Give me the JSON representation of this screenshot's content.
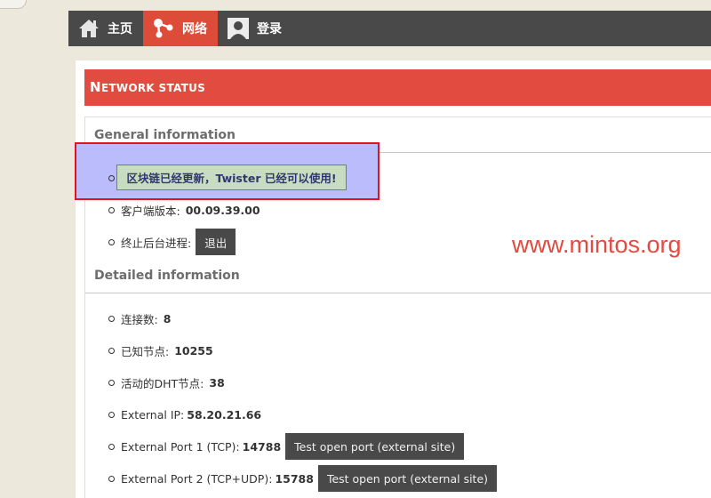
{
  "navbar": {
    "items": [
      {
        "label": "主页",
        "icon": "home-icon"
      },
      {
        "label": "网络",
        "icon": "network-icon",
        "active": true
      },
      {
        "label": "登录",
        "icon": "user-icon"
      }
    ]
  },
  "title": {
    "first": "N",
    "rest": "ETWORK STATUS"
  },
  "general": {
    "heading": "General information",
    "notice": "区块链已经更新，Twister 已经可以使用!",
    "client_version_label": "客户端版本:",
    "client_version": "00.09.39.00",
    "stop_label": "终止后台进程:",
    "stop_button": "退出"
  },
  "detailed": {
    "heading": "Detailed information",
    "connections_label": "连接数:",
    "connections": "8",
    "known_nodes_label": "已知节点:",
    "known_nodes": "10255",
    "dht_nodes_label": "活动的DHT节点:",
    "dht_nodes": "38",
    "ext_ip_label": "External IP:",
    "ext_ip": "58.20.21.66",
    "port1_label": "External Port 1 (TCP):",
    "port1": "14788",
    "port1_button": "Test open port (external site)",
    "port2_label": "External Port 2 (TCP+UDP):",
    "port2": "15788",
    "port2_button": "Test open port (external site)"
  },
  "watermark": "www.mintos.org",
  "colors": {
    "accent": "#e14b40",
    "navbar": "#494949",
    "highlight": "#bbbcfc",
    "notice_bg": "#c8dcc1"
  }
}
